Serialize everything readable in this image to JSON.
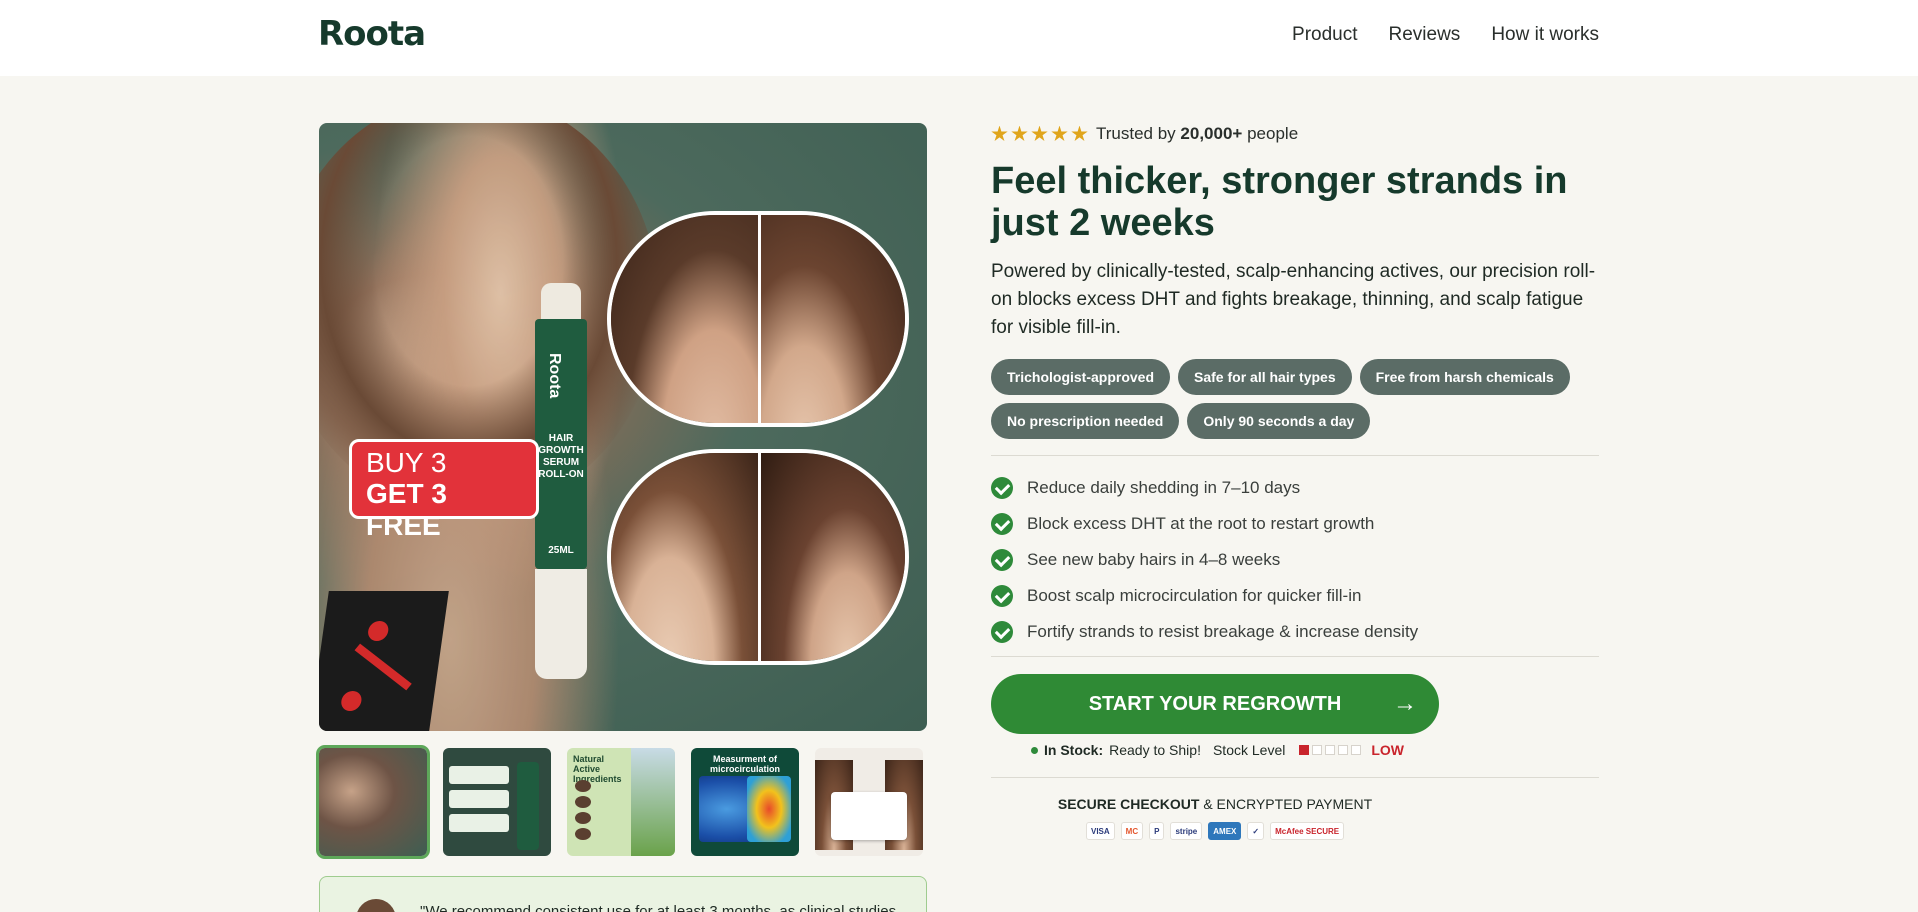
{
  "header": {
    "logo": "Roota",
    "nav": [
      "Product",
      "Reviews",
      "How it works"
    ]
  },
  "hero": {
    "bottle_brand": "Roota",
    "bottle_label": "HAIR GROWTH SERUM ROLL-ON",
    "bottle_volume": "25ML",
    "promo_line1": "BUY 3",
    "promo_line2": "GET 3 FREE"
  },
  "thumbnails": [
    {
      "caption": ""
    },
    {
      "caption": ""
    },
    {
      "caption": "Natural Active Ingredients"
    },
    {
      "caption": "Measurment of microcirculation"
    },
    {
      "caption": ""
    }
  ],
  "testimonial": {
    "quote": "\"We recommend consistent use for at least 3 months, as clinical studies"
  },
  "rating": {
    "stars": 5,
    "prefix": "Trusted by",
    "count": "20,000+",
    "suffix": "people"
  },
  "product": {
    "title": "Feel thicker, stronger strands in just 2 weeks",
    "description": "Powered by clinically-tested, scalp-enhancing actives, our precision roll-on blocks excess DHT and fights breakage, thinning, and scalp fatigue for visible fill-in.",
    "tags": [
      "Trichologist-approved",
      "Safe for all hair types",
      "Free from harsh chemicals",
      "No prescription needed",
      "Only 90 seconds a day"
    ],
    "benefits": [
      "Reduce daily shedding in 7–10 days",
      "Block excess DHT at the root to restart growth",
      "See new baby hairs in 4–8 weeks",
      "Boost scalp microcirculation for quicker fill-in",
      "Fortify strands to resist breakage & increase density"
    ]
  },
  "cta": {
    "label": "START YOUR REGROWTH",
    "arrow": "→"
  },
  "stock": {
    "status": "In Stock:",
    "ship_text": "Ready to Ship!",
    "level_label": "Stock Level",
    "level_filled": 1,
    "level_total": 5,
    "level_text": "LOW"
  },
  "checkout": {
    "bold": "SECURE CHECKOUT",
    "rest": "& ENCRYPTED PAYMENT",
    "payment_methods": [
      "VISA",
      "MC",
      "P",
      "stripe",
      "AMEX",
      "✓",
      "McAfee SECURE"
    ]
  },
  "colors": {
    "brand_dark": "#163a2c",
    "cta_green": "#2f8a35",
    "tag_bg": "#5b6c66",
    "low_red": "#c9242c",
    "star": "#e0a51b"
  }
}
